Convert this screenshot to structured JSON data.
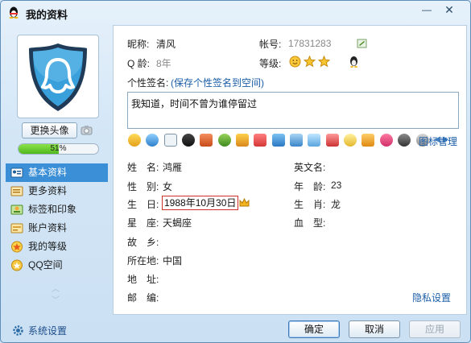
{
  "window": {
    "title": "我的资料",
    "minimize": "—",
    "close": "✕"
  },
  "left": {
    "change_avatar": "更换头像",
    "progress_percent": 51,
    "progress_text": "51%",
    "nav": [
      {
        "label": "基本资料",
        "icon": "profile-card-icon",
        "active": true
      },
      {
        "label": "更多资料",
        "icon": "more-info-icon",
        "active": false
      },
      {
        "label": "标签和印象",
        "icon": "tag-icon",
        "active": false
      },
      {
        "label": "账户资料",
        "icon": "account-icon",
        "active": false
      },
      {
        "label": "我的等级",
        "icon": "level-icon",
        "active": false
      },
      {
        "label": "QQ空间",
        "icon": "qzone-icon",
        "active": false
      }
    ],
    "settings": "系统设置"
  },
  "profile": {
    "nickname_label": "昵称:",
    "nickname": "清风",
    "account_label": "帐号:",
    "account": "17831283",
    "age_label": "Q 龄:",
    "age": "8年",
    "level_label": "等级:",
    "signature_label": "个性签名:",
    "save_signature": "(保存个性签名到空间)",
    "signature": "我知道，时间不曾为谁停留过",
    "icon_management": "图标管理"
  },
  "details": {
    "name_label": "姓　名:",
    "name": "鸿雁",
    "english_name_label": "英文名:",
    "english_name": "",
    "gender_label": "性　别:",
    "gender": "女",
    "age_label": "年　龄:",
    "age": "23",
    "birthday_label": "生　日:",
    "birthday": "1988年10月30日",
    "zodiac_label": "生　肖:",
    "zodiac": "龙",
    "constellation_label": "星　座:",
    "constellation": "天蝎座",
    "blood_label": "血　型:",
    "blood": "",
    "hometown_label": "故　乡:",
    "hometown": "",
    "location_label": "所在地:",
    "location": "中国",
    "address_label": "地　址:",
    "address": "",
    "postcode_label": "邮　编:",
    "postcode": "",
    "privacy": "隐私设置"
  },
  "buttons": {
    "ok": "确定",
    "cancel": "取消",
    "apply": "应用"
  },
  "colors": {
    "accent": "#3b8fd6",
    "link": "#1b5ea8",
    "highlight_border": "#d0302a"
  }
}
